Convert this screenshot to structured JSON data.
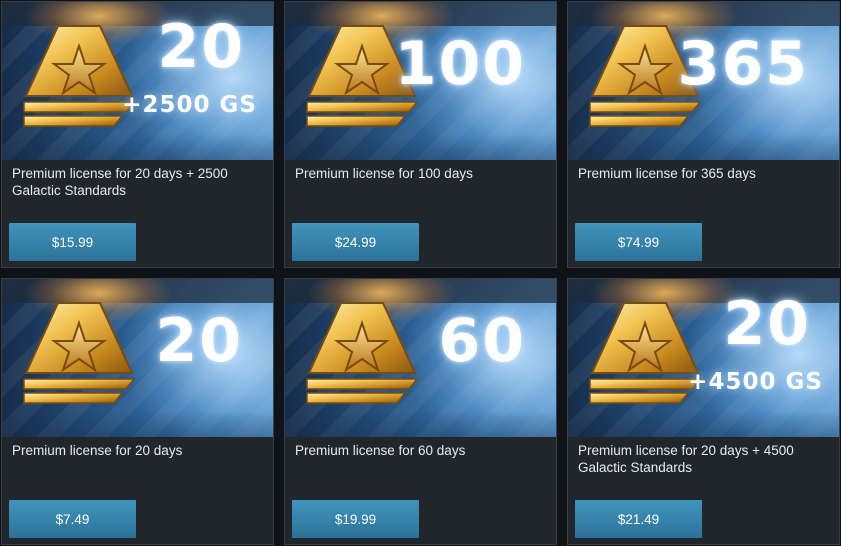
{
  "cards": [
    {
      "number": "20",
      "bonus": "+2500 GS",
      "description": "Premium license for 20 days + 2500 Galactic Standards",
      "price": "$15.99"
    },
    {
      "number": "100",
      "bonus": "",
      "description": "Premium license for 100 days",
      "price": "$24.99"
    },
    {
      "number": "365",
      "bonus": "",
      "description": "Premium license for 365 days",
      "price": "$74.99"
    },
    {
      "number": "20",
      "bonus": "",
      "description": "Premium license for 20 days",
      "price": "$7.49"
    },
    {
      "number": "60",
      "bonus": "",
      "description": "Premium license for 60 days",
      "price": "$19.99"
    },
    {
      "number": "20",
      "bonus": "+4500 GS",
      "description": "Premium license for 20 days + 4500 Galactic Standards",
      "price": "$21.49"
    }
  ],
  "icons": {
    "badge": "premium-star-badge-icon"
  },
  "colors": {
    "button": "#3584ad",
    "card": "#21262c",
    "badge_gold": "#e8b64a"
  }
}
